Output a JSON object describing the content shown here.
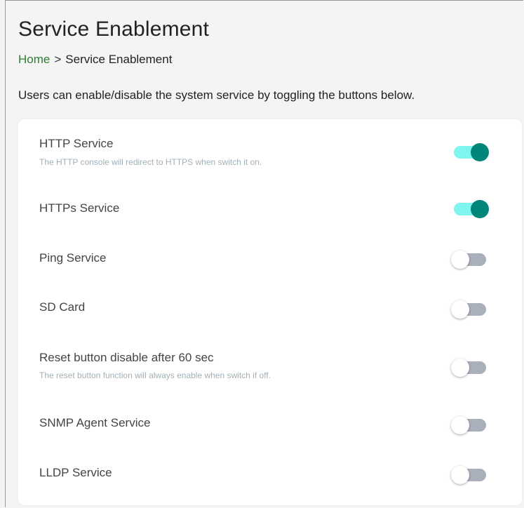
{
  "page": {
    "title": "Service Enablement",
    "breadcrumb": {
      "home": "Home",
      "separator": ">",
      "current": "Service Enablement"
    },
    "description": "Users can enable/disable the system service by toggling the buttons below."
  },
  "services": [
    {
      "label": "HTTP Service",
      "description": "The HTTP console will redirect to HTTPS when switch it on.",
      "enabled": true
    },
    {
      "label": "HTTPs Service",
      "description": "",
      "enabled": true
    },
    {
      "label": "Ping Service",
      "description": "",
      "enabled": false
    },
    {
      "label": "SD Card",
      "description": "",
      "enabled": false
    },
    {
      "label": "Reset button disable after 60 sec",
      "description": "The reset button function will always enable when switch if off.",
      "enabled": false
    },
    {
      "label": "SNMP Agent Service",
      "description": "",
      "enabled": false
    },
    {
      "label": "LLDP Service",
      "description": "",
      "enabled": false
    }
  ],
  "colors": {
    "toggle_on_track": "#7ff5ef",
    "toggle_on_thumb": "#00857a",
    "toggle_off_track": "#a9b0bb",
    "toggle_off_thumb": "#ffffff",
    "breadcrumb_link": "#2e7d32"
  }
}
